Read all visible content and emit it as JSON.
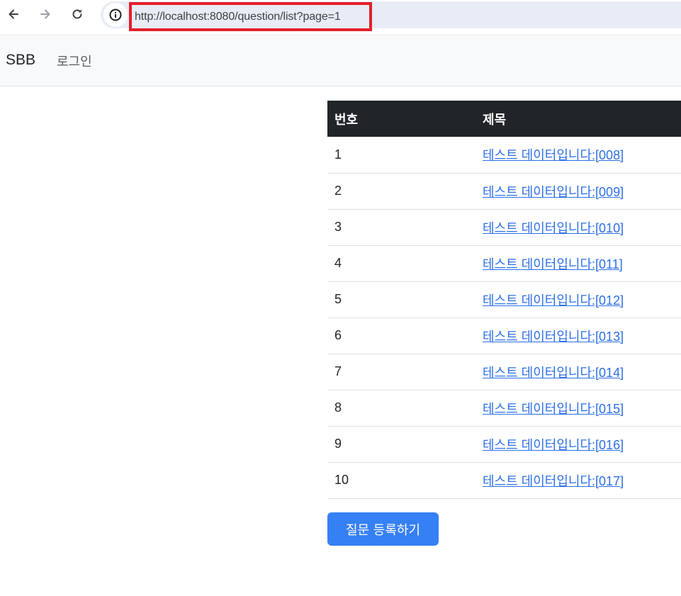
{
  "browser": {
    "url": "http://localhost:8080/question/list?page=1",
    "highlight_color": "#e3202b"
  },
  "navbar": {
    "brand": "SBB",
    "login_label": "로그인"
  },
  "table": {
    "headers": {
      "number": "번호",
      "title": "제목"
    },
    "rows": [
      {
        "number": "1",
        "title": "테스트 데이터입니다:[008]"
      },
      {
        "number": "2",
        "title": "테스트 데이터입니다:[009]"
      },
      {
        "number": "3",
        "title": "테스트 데이터입니다:[010]"
      },
      {
        "number": "4",
        "title": "테스트 데이터입니다:[011]"
      },
      {
        "number": "5",
        "title": "테스트 데이터입니다:[012]"
      },
      {
        "number": "6",
        "title": "테스트 데이터입니다:[013]"
      },
      {
        "number": "7",
        "title": "테스트 데이터입니다:[014]"
      },
      {
        "number": "8",
        "title": "테스트 데이터입니다:[015]"
      },
      {
        "number": "9",
        "title": "테스트 데이터입니다:[016]"
      },
      {
        "number": "10",
        "title": "테스트 데이터입니다:[017]"
      }
    ]
  },
  "actions": {
    "create_question_label": "질문 등록하기"
  },
  "colors": {
    "header_bg": "#212529",
    "link": "#2c6fe8",
    "primary_button": "#3680f5"
  }
}
